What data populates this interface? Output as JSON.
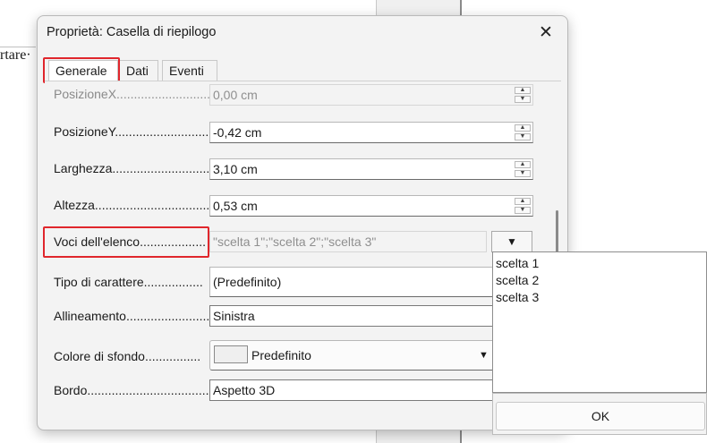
{
  "document": {
    "visible_text": "rtare·"
  },
  "dialog": {
    "title": "Proprietà: Casella di riepilogo",
    "close_glyph": "✕",
    "tabs": [
      {
        "label": "Generale",
        "active": true
      },
      {
        "label": "Dati",
        "active": false
      },
      {
        "label": "Eventi",
        "active": false
      }
    ],
    "fields": {
      "posizione_x": {
        "label": "PosizioneX",
        "dots": "..............................",
        "value": "0,00 cm",
        "disabled": true
      },
      "posizione_y": {
        "label": "PosizioneY",
        "dots": "..............................",
        "value": "-0,42 cm"
      },
      "larghezza": {
        "label": "Larghezza",
        "dots": "..............................",
        "value": "3,10 cm"
      },
      "altezza": {
        "label": "Altezza",
        "dots": "..................................",
        "value": "0,53 cm"
      },
      "voci_elenco": {
        "label": "Voci dell'elenco",
        "dots": "...................",
        "value": "\"scelta 1\";\"scelta 2\";\"scelta 3\""
      },
      "tipo_carattere": {
        "label": "Tipo di carattere",
        "dots": ".................",
        "value": "(Predefinito)"
      },
      "allineamento": {
        "label": "Allineamento",
        "dots": ".........................",
        "value": "Sinistra"
      },
      "colore_sfondo": {
        "label": "Colore di sfondo",
        "dots": "................",
        "value": "Predefinito"
      },
      "bordo": {
        "label": "Bordo",
        "dots": "........................................",
        "value": "Aspetto 3D"
      }
    },
    "spin_up": "▲",
    "spin_down": "▼",
    "dropdown_arrow": "▼"
  },
  "list_popup": {
    "items": [
      "scelta 1",
      "scelta 2",
      "scelta 3"
    ],
    "ok_label": "OK"
  },
  "colors": {
    "highlight": "#e0262c",
    "dialog_bg": "#f3f3f3"
  }
}
